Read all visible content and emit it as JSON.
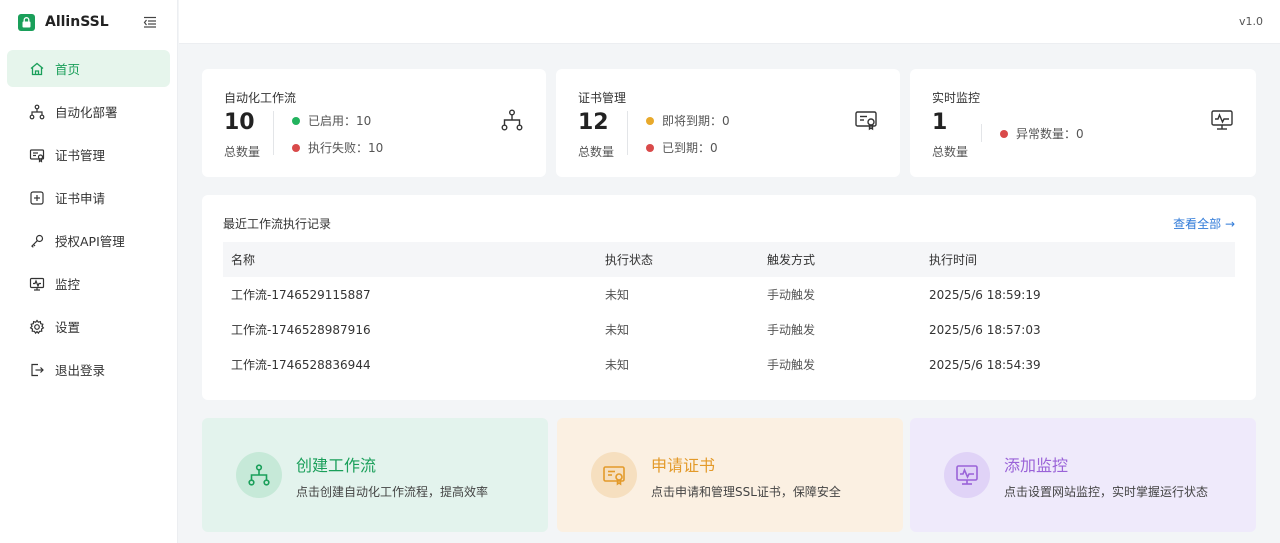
{
  "app": {
    "name": "AllinSSL",
    "version": "v1.0"
  },
  "sidebar": {
    "items": [
      {
        "label": "首页",
        "icon": "home-icon",
        "active": true
      },
      {
        "label": "自动化部署",
        "icon": "workflow-icon",
        "active": false
      },
      {
        "label": "证书管理",
        "icon": "certificate-icon",
        "active": false
      },
      {
        "label": "证书申请",
        "icon": "plus-square-icon",
        "active": false
      },
      {
        "label": "授权API管理",
        "icon": "key-icon",
        "active": false
      },
      {
        "label": "监控",
        "icon": "monitor-icon",
        "active": false
      },
      {
        "label": "设置",
        "icon": "gear-icon",
        "active": false
      },
      {
        "label": "退出登录",
        "icon": "logout-icon",
        "active": false
      }
    ]
  },
  "stats": {
    "workflow": {
      "title": "自动化工作流",
      "count": "10",
      "sub": "总数量",
      "line1": "已启用：10",
      "line2": "执行失败：10"
    },
    "cert": {
      "title": "证书管理",
      "count": "12",
      "sub": "总数量",
      "line1": "即将到期：0",
      "line2": "已到期：0"
    },
    "monitor": {
      "title": "实时监控",
      "count": "1",
      "sub": "总数量",
      "line1": "异常数量：0"
    }
  },
  "recent": {
    "title": "最近工作流执行记录",
    "view_all": "查看全部 →",
    "columns": [
      "名称",
      "执行状态",
      "触发方式",
      "执行时间"
    ],
    "rows": [
      [
        "工作流-1746529115887",
        "未知",
        "手动触发",
        "2025/5/6 18:59:19"
      ],
      [
        "工作流-1746528987916",
        "未知",
        "手动触发",
        "2025/5/6 18:57:03"
      ],
      [
        "工作流-1746528836944",
        "未知",
        "手动触发",
        "2025/5/6 18:54:39"
      ]
    ]
  },
  "actions": {
    "workflow": {
      "title": "创建工作流",
      "desc": "点击创建自动化工作流程，提高效率"
    },
    "cert": {
      "title": "申请证书",
      "desc": "点击申请和管理SSL证书，保障安全"
    },
    "monitor": {
      "title": "添加监控",
      "desc": "点击设置网站监控，实时掌握运行状态"
    }
  },
  "colors": {
    "brand": "#1a9f5a",
    "green_dot": "#22b35e",
    "red_dot": "#d94a4a",
    "yellow_dot": "#e8a92b",
    "link": "#2f7ad8",
    "workflow_bg": "#e3f3ed",
    "cert_bg": "#fbf0e2",
    "monitor_bg": "#efeafb"
  }
}
